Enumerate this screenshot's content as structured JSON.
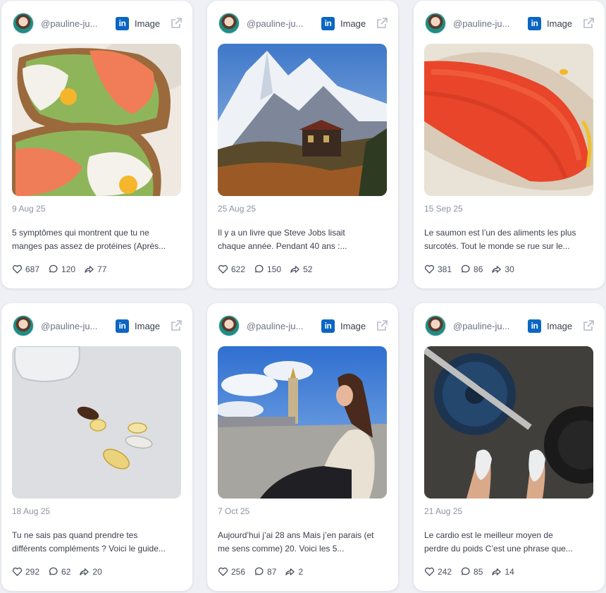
{
  "posts": [
    {
      "handle": "@pauline-ju...",
      "platform": "linkedin",
      "type": "Image",
      "date": "9 Aug 25",
      "caption_line1": "5 symptômes qui montrent que tu ne",
      "caption_line2": "manges pas assez de protéines (Après...",
      "likes": "687",
      "comments": "120",
      "shares": "77"
    },
    {
      "handle": "@pauline-ju...",
      "platform": "linkedin",
      "type": "Image",
      "date": "25 Aug 25",
      "caption_line1": "Il y a un livre que Steve Jobs lisait",
      "caption_line2": "chaque année. Pendant 40 ans :...",
      "likes": "622",
      "comments": "150",
      "shares": "52"
    },
    {
      "handle": "@pauline-ju...",
      "platform": "linkedin",
      "type": "Image",
      "date": "15 Sep 25",
      "caption_line1": "Le saumon est l’un des aliments les plus",
      "caption_line2": "surcotés. Tout le monde se rue sur le...",
      "likes": "381",
      "comments": "86",
      "shares": "30"
    },
    {
      "handle": "@pauline-ju...",
      "platform": "linkedin",
      "type": "Image",
      "date": "18 Aug 25",
      "caption_line1": "Tu ne sais pas quand prendre tes",
      "caption_line2": "différents compléments ? Voici le guide...",
      "likes": "292",
      "comments": "62",
      "shares": "20"
    },
    {
      "handle": "@pauline-ju...",
      "platform": "linkedin",
      "type": "Image",
      "date": "7 Oct 25",
      "caption_line1": "Aujourd’hui j’ai 28 ans Mais j’en parais (et",
      "caption_line2": "me sens comme) 20. Voici les 5...",
      "likes": "256",
      "comments": "87",
      "shares": "2"
    },
    {
      "handle": "@pauline-ju...",
      "platform": "linkedin",
      "type": "Image",
      "date": "21 Aug 25",
      "caption_line1": "Le cardio est le meilleur moyen de",
      "caption_line2": "perdre du poids C’est une phrase que...",
      "likes": "242",
      "comments": "85",
      "shares": "14"
    }
  ],
  "icons": {
    "platform": "linkedin-icon",
    "external": "external-link-icon",
    "likes": "heart-icon",
    "comments": "comment-icon",
    "shares": "share-icon"
  },
  "colors": {
    "linkedin": "#0a66c2",
    "card": "#ffffff",
    "background": "#eef0f5"
  }
}
